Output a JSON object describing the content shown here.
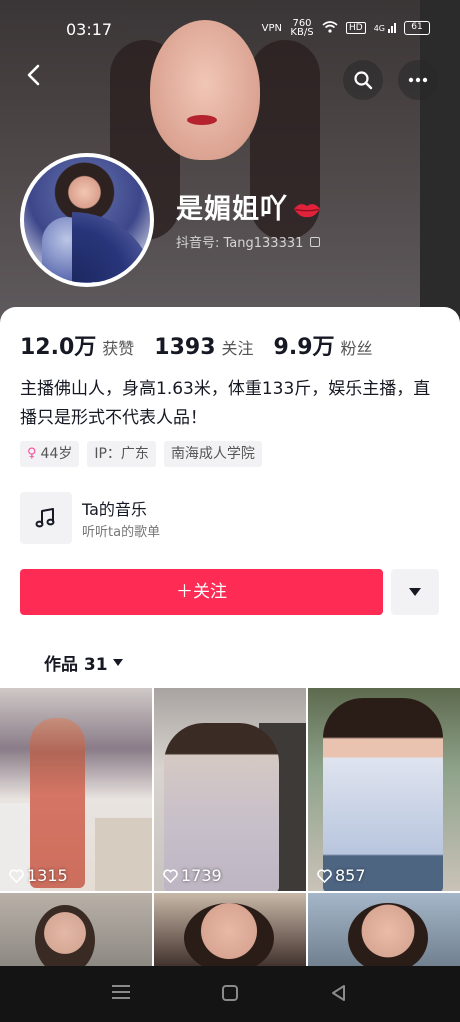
{
  "status_bar": {
    "time": "03:17",
    "vpn": "VPN",
    "speed": "760 KB/S",
    "hd": "HD",
    "network": "4G",
    "battery": "61"
  },
  "header": {
    "nickname": "是媚姐吖",
    "douyin_id": "抖音号: Tang133331"
  },
  "stats": [
    {
      "num": "12.0万",
      "label": "获赞"
    },
    {
      "num": "1393",
      "label": "关注"
    },
    {
      "num": "9.9万",
      "label": "粉丝"
    }
  ],
  "bio": "主播佛山人，身高1.63米，体重133斤，娱乐主播，直播只是形式不代表人品！",
  "tags": {
    "age": "44岁",
    "ip": "IP：广东",
    "school": "南海成人学院"
  },
  "music": {
    "title": "Ta的音乐",
    "subtitle": "听听ta的歌单"
  },
  "follow_label": "＋关注",
  "works_tab": "作品 31",
  "videos": [
    {
      "likes": "1315"
    },
    {
      "likes": "1739"
    },
    {
      "likes": "857"
    },
    {
      "likes": ""
    },
    {
      "likes": ""
    },
    {
      "likes": ""
    }
  ],
  "colors": {
    "accent": "#fe2c55",
    "tag_bg": "#f2f2f4",
    "text": "#161823"
  }
}
